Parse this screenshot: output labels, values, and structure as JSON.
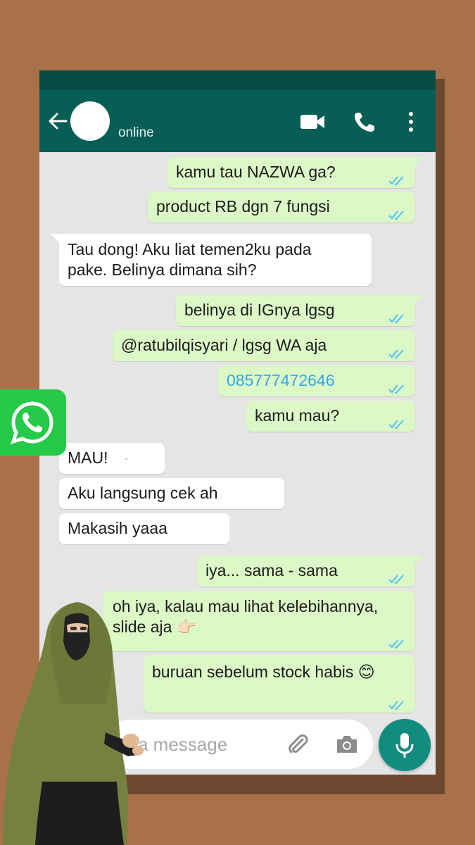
{
  "header": {
    "status": "online",
    "icons": [
      "back-arrow-icon",
      "avatar",
      "video-call-icon",
      "phone-call-icon",
      "more-vert-icon"
    ]
  },
  "messages": [
    {
      "dir": "out",
      "lines": [
        "kamu tau NAZWA ga?"
      ]
    },
    {
      "dir": "out",
      "lines": [
        "product RB dgn 7 fungsi"
      ]
    },
    {
      "dir": "in",
      "lines": [
        "Tau dong! Aku liat temen2ku pada",
        "pake. Belinya dimana sih?"
      ]
    },
    {
      "dir": "out",
      "lines": [
        "belinya di IGnya lgsg"
      ]
    },
    {
      "dir": "out",
      "lines": [
        "@ratubilqisyari / lgsg WA aja"
      ]
    },
    {
      "dir": "out",
      "lines": [
        "085777472646"
      ],
      "link": true
    },
    {
      "dir": "out",
      "lines": [
        "kamu mau?"
      ]
    },
    {
      "dir": "in",
      "lines": [
        "MAU!"
      ]
    },
    {
      "dir": "in",
      "lines": [
        "Aku langsung cek ah"
      ]
    },
    {
      "dir": "in",
      "lines": [
        "Makasih yaaa"
      ]
    },
    {
      "dir": "out",
      "lines": [
        "iya... sama - sama"
      ]
    },
    {
      "dir": "out",
      "lines": [
        "oh iya, kalau mau lihat kelebihannya,",
        "slide aja 👉🏻"
      ]
    },
    {
      "dir": "out",
      "lines": [
        "buruan sebelum stock habis 😊"
      ]
    }
  ],
  "composer": {
    "placeholder": "a message",
    "icons": [
      "attach-icon",
      "camera-icon",
      "mic-icon"
    ]
  },
  "colors": {
    "header": "#075e54",
    "outgoing": "#dcf8c6",
    "incoming": "#ffffff",
    "ticks": "#4fc3f7",
    "link": "#34a7e6",
    "whatsapp_badge": "#25ca48"
  }
}
